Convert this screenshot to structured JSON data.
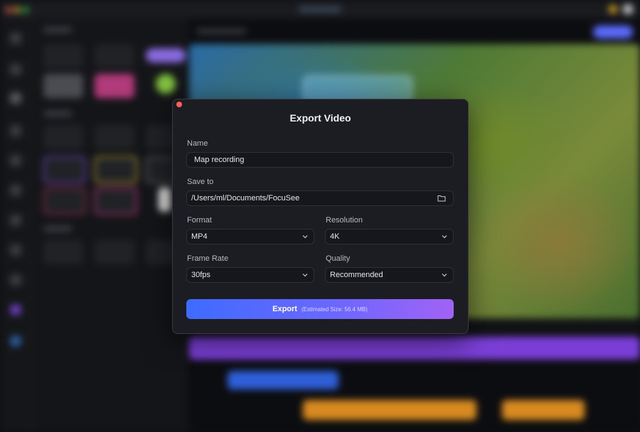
{
  "dialog": {
    "title": "Export Video",
    "name_label": "Name",
    "name_value": "Map recording",
    "save_label": "Save to",
    "save_path": "/Users/ml/Documents/FocuSee",
    "format_label": "Format",
    "format_value": "MP4",
    "resolution_label": "Resolution",
    "resolution_value": "4K",
    "frame_rate_label": "Frame Rate",
    "frame_rate_value": "30fps",
    "quality_label": "Quality",
    "quality_value": "Recommended",
    "export_label": "Export",
    "estimated_size": "(Estimated Size: 56.4 MB)"
  },
  "colors": {
    "accent_start": "#3f6bff",
    "accent_end": "#a262f5",
    "close": "#ff5f57"
  },
  "icons": [
    "close-dot-icon",
    "folder-icon",
    "chevron-down-icon"
  ]
}
